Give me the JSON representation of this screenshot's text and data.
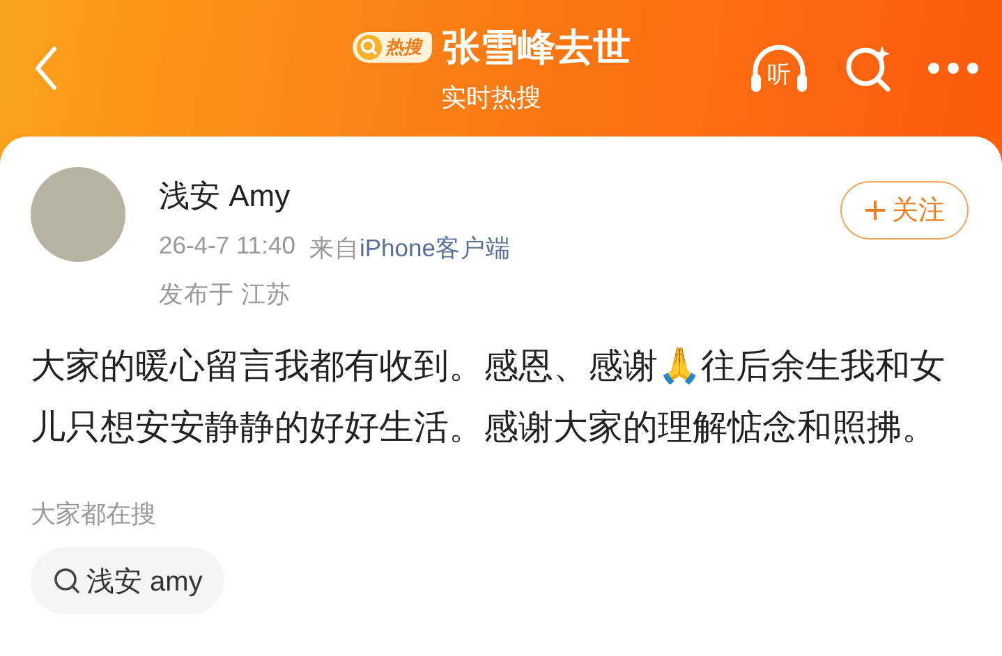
{
  "header": {
    "badge": "热搜",
    "title": "张雪峰去世",
    "subtitle": "实时热搜",
    "listen": "听"
  },
  "post": {
    "author": "浅安 Amy",
    "time": "26-4-7 11:40",
    "source_prefix": "来自",
    "source": "iPhone客户端",
    "location": "发布于 江苏",
    "follow": "关注",
    "text": "大家的暖心留言我都有收到。感恩、感谢🙏往后余生我和女儿只想安安静静的好好生活。感谢大家的理解惦念和照拂。"
  },
  "related": {
    "heading": "大家都在搜",
    "items": [
      "浅安 amy"
    ]
  }
}
